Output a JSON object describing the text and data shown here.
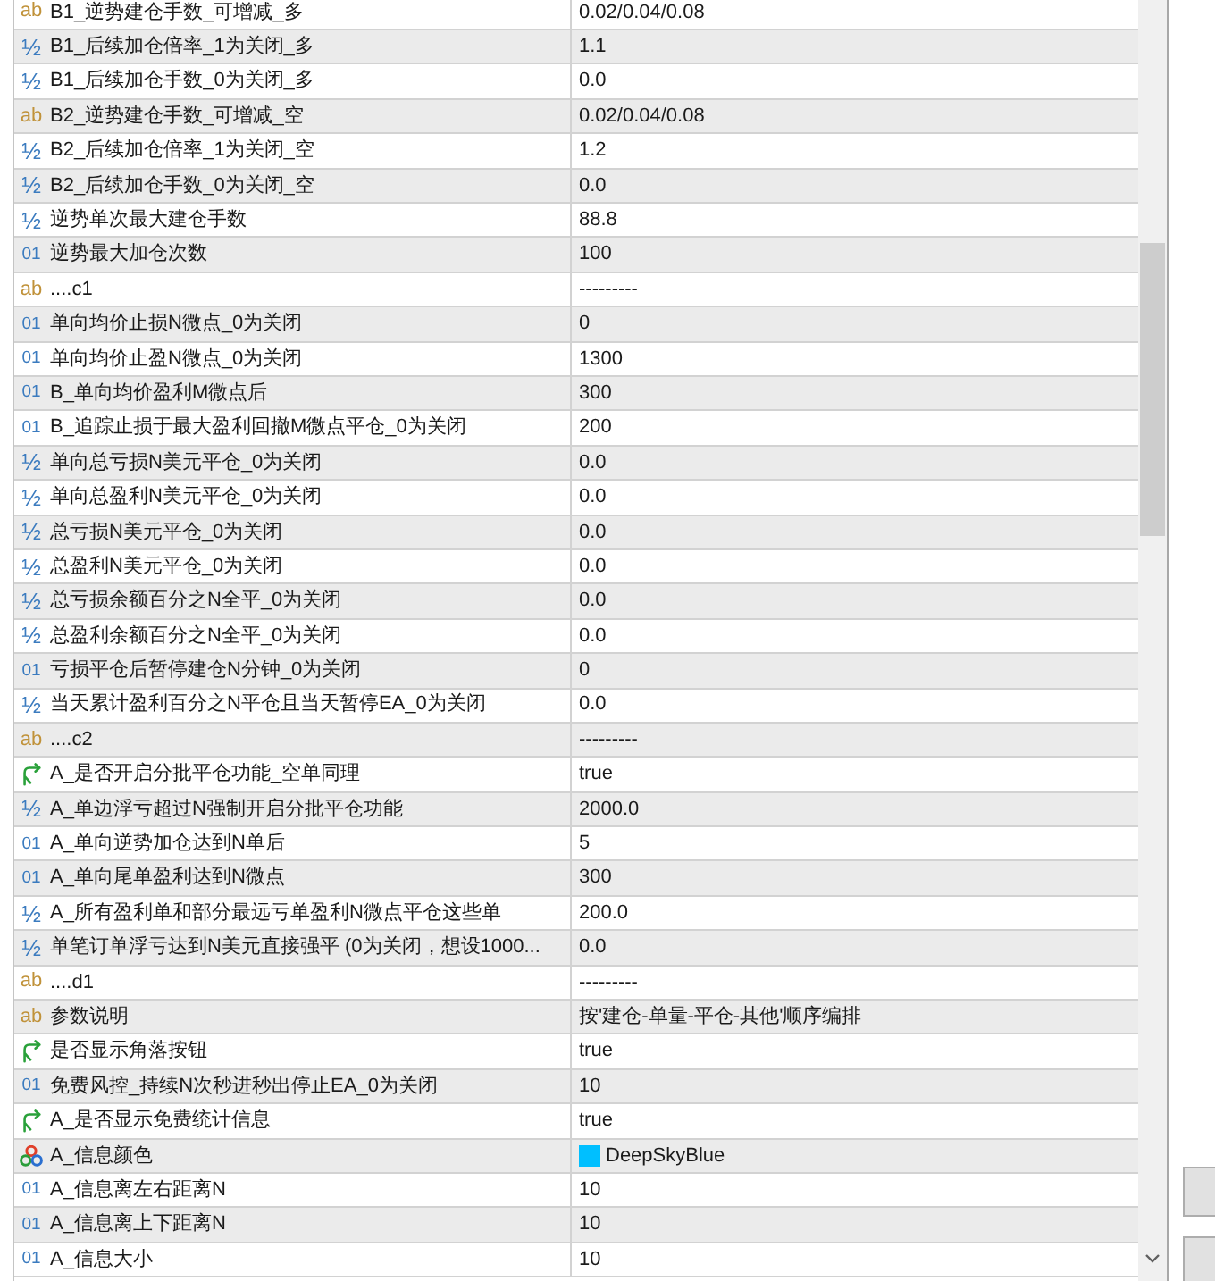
{
  "rows": [
    {
      "kind": "string",
      "icon": "ab",
      "name": "B1_逆势建仓手数_可增减_多",
      "value": "0.02/0.04/0.08"
    },
    {
      "kind": "double",
      "icon": "½",
      "name": "B1_后续加仓倍率_1为关闭_多",
      "value": "1.1"
    },
    {
      "kind": "double",
      "icon": "½",
      "name": "B1_后续加仓手数_0为关闭_多",
      "value": "0.0"
    },
    {
      "kind": "string",
      "icon": "ab",
      "name": "B2_逆势建仓手数_可增减_空",
      "value": "0.02/0.04/0.08"
    },
    {
      "kind": "double",
      "icon": "½",
      "name": "B2_后续加仓倍率_1为关闭_空",
      "value": "1.2"
    },
    {
      "kind": "double",
      "icon": "½",
      "name": "B2_后续加仓手数_0为关闭_空",
      "value": "0.0"
    },
    {
      "kind": "double",
      "icon": "½",
      "name": "逆势单次最大建仓手数",
      "value": "88.8"
    },
    {
      "kind": "int",
      "icon": "01",
      "name": "逆势最大加仓次数",
      "value": "100"
    },
    {
      "kind": "string",
      "icon": "ab",
      "name": "....c1",
      "value": "---------"
    },
    {
      "kind": "int",
      "icon": "01",
      "name": "单向均价止损N微点_0为关闭",
      "value": "0"
    },
    {
      "kind": "int",
      "icon": "01",
      "name": "单向均价止盈N微点_0为关闭",
      "value": "1300"
    },
    {
      "kind": "int",
      "icon": "01",
      "name": "B_单向均价盈利M微点后",
      "value": "300"
    },
    {
      "kind": "int",
      "icon": "01",
      "name": "B_追踪止损于最大盈利回撤M微点平仓_0为关闭",
      "value": "200"
    },
    {
      "kind": "double",
      "icon": "½",
      "name": "单向总亏损N美元平仓_0为关闭",
      "value": "0.0"
    },
    {
      "kind": "double",
      "icon": "½",
      "name": "单向总盈利N美元平仓_0为关闭",
      "value": "0.0"
    },
    {
      "kind": "double",
      "icon": "½",
      "name": "总亏损N美元平仓_0为关闭",
      "value": "0.0"
    },
    {
      "kind": "double",
      "icon": "½",
      "name": "总盈利N美元平仓_0为关闭",
      "value": "0.0"
    },
    {
      "kind": "double",
      "icon": "½",
      "name": "总亏损余额百分之N全平_0为关闭",
      "value": "0.0"
    },
    {
      "kind": "double",
      "icon": "½",
      "name": "总盈利余额百分之N全平_0为关闭",
      "value": "0.0"
    },
    {
      "kind": "int",
      "icon": "01",
      "name": "亏损平仓后暂停建仓N分钟_0为关闭",
      "value": "0"
    },
    {
      "kind": "double",
      "icon": "½",
      "name": "当天累计盈利百分之N平仓且当天暂停EA_0为关闭",
      "value": "0.0"
    },
    {
      "kind": "string",
      "icon": "ab",
      "name": "....c2",
      "value": "---------"
    },
    {
      "kind": "bool",
      "name": "A_是否开启分批平仓功能_空单同理",
      "value": "true"
    },
    {
      "kind": "double",
      "icon": "½",
      "name": "A_单边浮亏超过N强制开启分批平仓功能",
      "value": "2000.0"
    },
    {
      "kind": "int",
      "icon": "01",
      "name": "A_单向逆势加仓达到N单后",
      "value": "5"
    },
    {
      "kind": "int",
      "icon": "01",
      "name": "A_单向尾单盈利达到N微点",
      "value": "300"
    },
    {
      "kind": "double",
      "icon": "½",
      "name": "A_所有盈利单和部分最远亏单盈利N微点平仓这些单",
      "value": "200.0"
    },
    {
      "kind": "double",
      "icon": "½",
      "name": "单笔订单浮亏达到N美元直接强平 (0为关闭，想设1000...",
      "value": "0.0"
    },
    {
      "kind": "string",
      "icon": "ab",
      "name": "....d1",
      "value": "---------"
    },
    {
      "kind": "string",
      "icon": "ab",
      "name": "参数说明",
      "value": "按'建仓-单量-平仓-其他'顺序编排"
    },
    {
      "kind": "bool",
      "name": "是否显示角落按钮",
      "value": "true"
    },
    {
      "kind": "int",
      "icon": "01",
      "name": "免费风控_持续N次秒进秒出停止EA_0为关闭",
      "value": "10"
    },
    {
      "kind": "bool",
      "name": "A_是否显示免费统计信息",
      "value": "true"
    },
    {
      "kind": "color",
      "name": "A_信息颜色",
      "value": "DeepSkyBlue",
      "color": "#00bfff"
    },
    {
      "kind": "int",
      "icon": "01",
      "name": "A_信息离左右距离N",
      "value": "10"
    },
    {
      "kind": "int",
      "icon": "01",
      "name": "A_信息离上下距离N",
      "value": "10"
    },
    {
      "kind": "int",
      "icon": "01",
      "name": "A_信息大小",
      "value": "10"
    }
  ]
}
